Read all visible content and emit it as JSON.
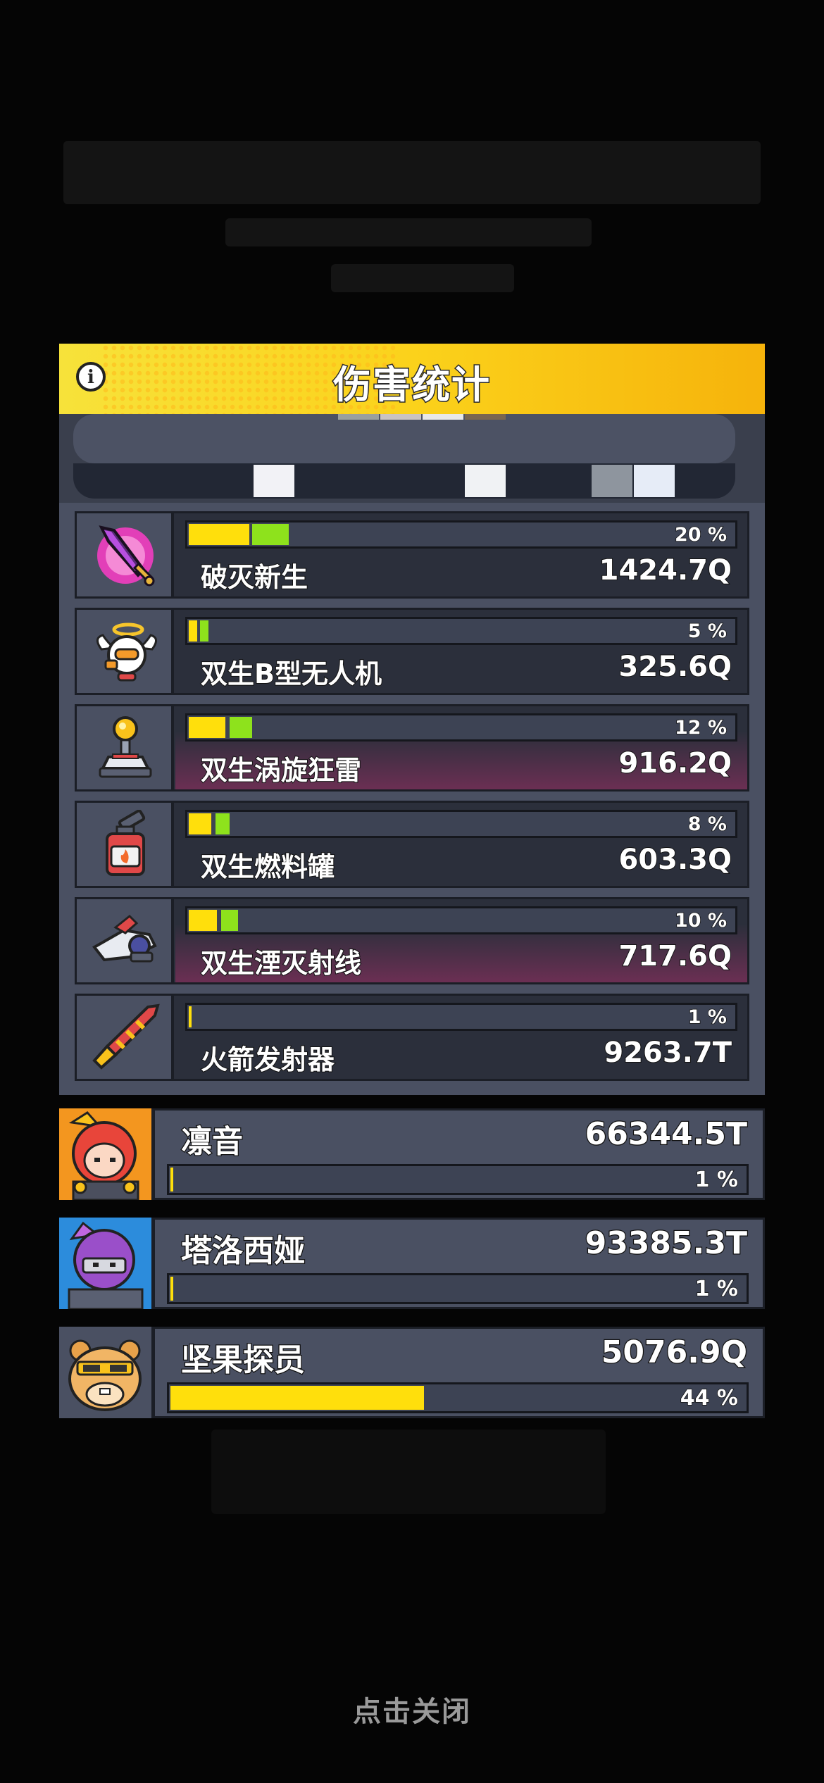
{
  "panel": {
    "title": "伤害统计"
  },
  "skills": [
    {
      "icon": "void-sword-icon",
      "name": "破灭新生",
      "damage": "1424.7Q",
      "percent": 20,
      "percent_label": "20 %",
      "highlight": false
    },
    {
      "icon": "angel-drone-icon",
      "name": "双生B型无人机",
      "damage": "325.6Q",
      "percent": 5,
      "percent_label": "5 %",
      "highlight": false
    },
    {
      "icon": "thunder-orb-icon",
      "name": "双生涡旋狂雷",
      "damage": "916.2Q",
      "percent": 12,
      "percent_label": "12 %",
      "highlight": true
    },
    {
      "icon": "fuel-tank-icon",
      "name": "双生燃料罐",
      "damage": "603.3Q",
      "percent": 8,
      "percent_label": "8 %",
      "highlight": false
    },
    {
      "icon": "laser-gun-icon",
      "name": "双生湮灭射线",
      "damage": "717.6Q",
      "percent": 10,
      "percent_label": "10 %",
      "highlight": true
    },
    {
      "icon": "rocket-launcher-icon",
      "name": "火箭发射器",
      "damage": "9263.7T",
      "percent": 1,
      "percent_label": "1 %",
      "highlight": false
    }
  ],
  "heroes": [
    {
      "icon": "red-hair-girl-portrait",
      "name": "凛音",
      "damage": "66344.5T",
      "percent": 1,
      "percent_label": "1 %"
    },
    {
      "icon": "purple-ninja-portrait",
      "name": "塔洛西娅",
      "damage": "93385.3T",
      "percent": 1,
      "percent_label": "1 %"
    },
    {
      "icon": "hamster-scout-portrait",
      "name": "坚果探员",
      "damage": "5076.9Q",
      "percent": 44,
      "percent_label": "44 %"
    }
  ],
  "footer": {
    "close_hint": "点击关闭"
  },
  "colors": {
    "bar_yellow": "#ffdf0c",
    "bar_green": "#8ee21c",
    "header_yellow": "#fbd21b",
    "panel_bg": "#4a5062"
  }
}
